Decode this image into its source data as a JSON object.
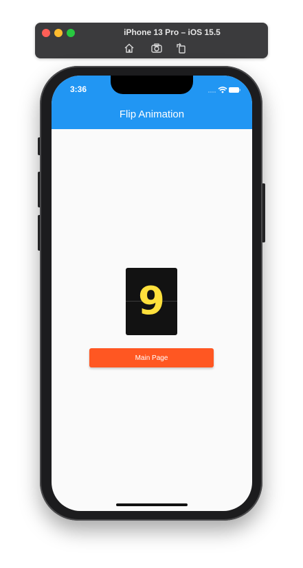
{
  "simulator": {
    "title": "iPhone 13 Pro – iOS 15.5",
    "tools": [
      "home-icon",
      "screenshot-icon",
      "rotate-icon"
    ]
  },
  "status_bar": {
    "time": "3:36",
    "icons": [
      "signal-icon",
      "wifi-icon",
      "battery-icon"
    ]
  },
  "app_bar": {
    "title": "Flip Animation",
    "color": "#2196f3"
  },
  "flip_card": {
    "digit": "9",
    "digit_color": "#ffe03c",
    "card_color": "#121212"
  },
  "main_button": {
    "label": "Main Page",
    "color": "#ff5722"
  }
}
